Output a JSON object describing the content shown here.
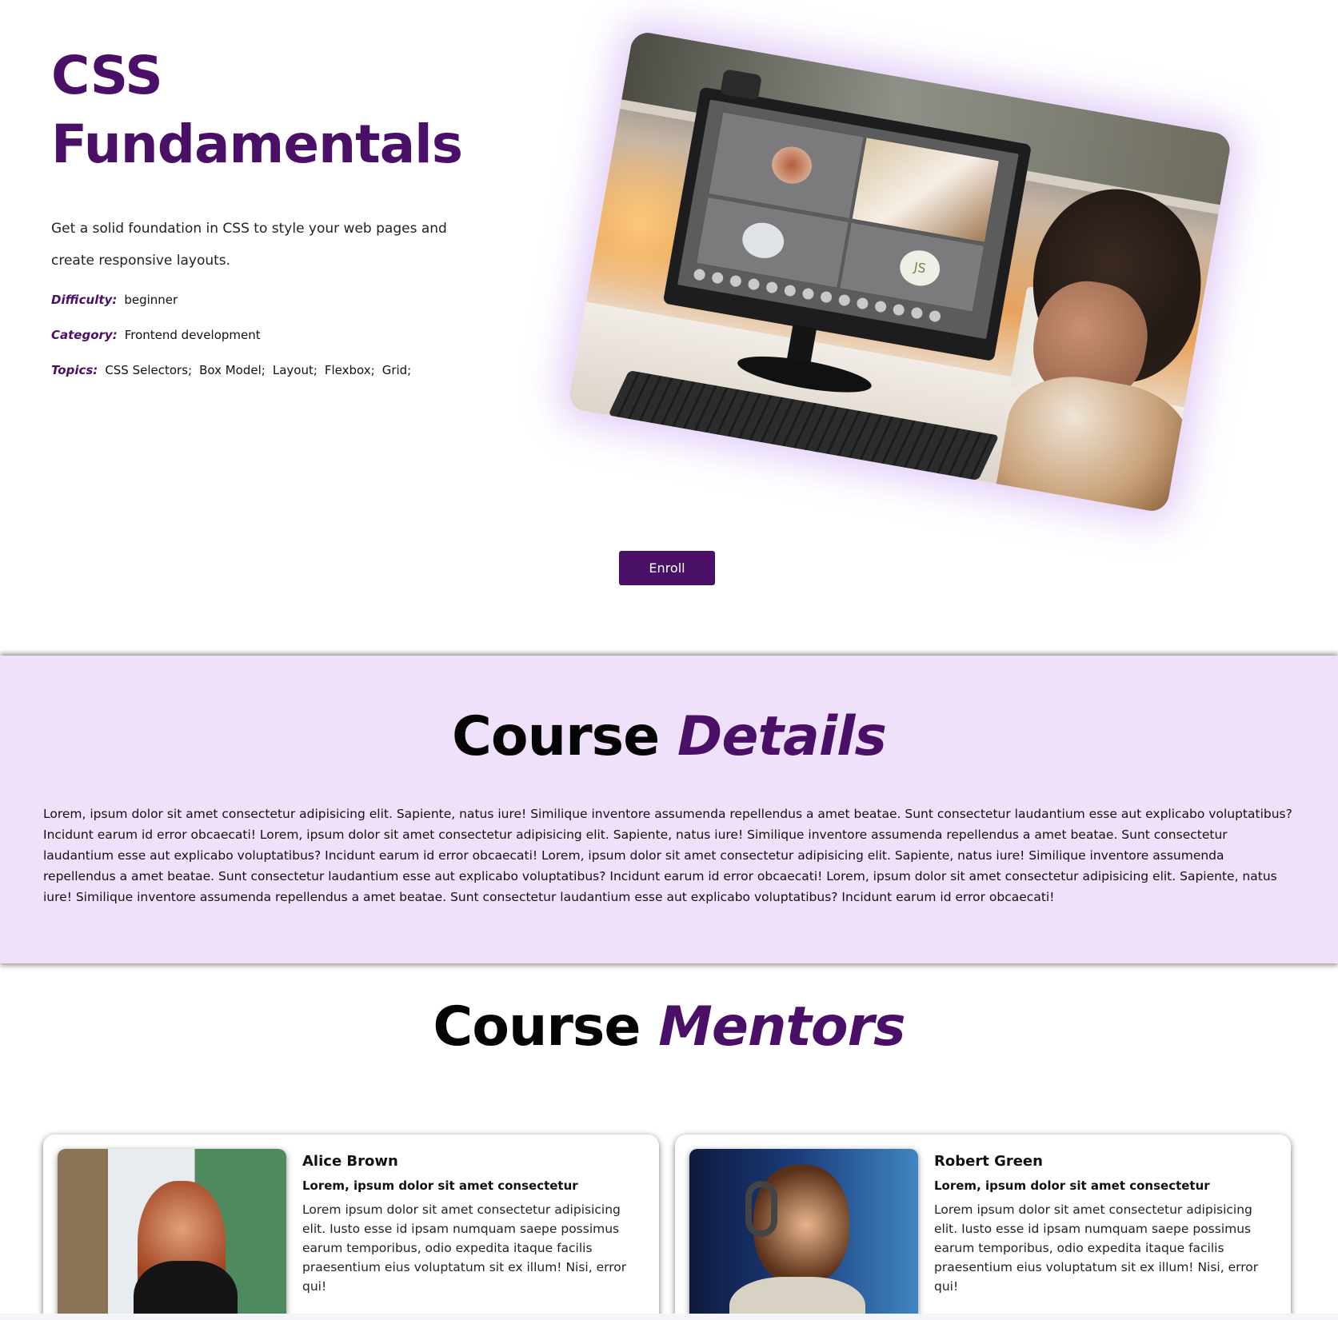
{
  "hero": {
    "title_line1": "CSS",
    "title_line2": "Fundamentals",
    "description": "Get a solid foundation in CSS to style your web pages and create responsive layouts.",
    "difficulty_label": "Difficulty:",
    "difficulty_value": "beginner",
    "category_label": "Category:",
    "category_value": "Frontend development",
    "topics_label": "Topics:",
    "topics": [
      "CSS Selectors;",
      "Box Model;",
      "Layout;",
      "Flexbox;",
      "Grid;"
    ],
    "image_caption_avatar": "JS",
    "enroll_label": "Enroll"
  },
  "details": {
    "title_plain": "Course",
    "title_accent": "Details",
    "body": "Lorem, ipsum dolor sit amet consectetur adipisicing elit. Sapiente, natus iure! Similique inventore assumenda repellendus a amet beatae. Sunt consectetur laudantium esse aut explicabo voluptatibus? Incidunt earum id error obcaecati! Lorem, ipsum dolor sit amet consectetur adipisicing elit. Sapiente, natus iure! Similique inventore assumenda repellendus a amet beatae. Sunt consectetur laudantium esse aut explicabo voluptatibus? Incidunt earum id error obcaecati! Lorem, ipsum dolor sit amet consectetur adipisicing elit. Sapiente, natus iure! Similique inventore assumenda repellendus a amet beatae. Sunt consectetur laudantium esse aut explicabo voluptatibus? Incidunt earum id error obcaecati! Lorem, ipsum dolor sit amet consectetur adipisicing elit. Sapiente, natus iure! Similique inventore assumenda repellendus a amet beatae. Sunt consectetur laudantium esse aut explicabo voluptatibus? Incidunt earum id error obcaecati!"
  },
  "mentors": {
    "title_plain": "Course",
    "title_accent": "Mentors",
    "items": [
      {
        "name": "Alice Brown",
        "subtitle": "Lorem, ipsum dolor sit amet consectetur",
        "bio": "Lorem ipsum dolor sit amet consectetur adipisicing elit. Iusto esse id ipsam numquam saepe possimus earum temporibus, odio expedita itaque facilis praesentium eius voluptatum sit ex illum! Nisi, error qui!"
      },
      {
        "name": "Robert Green",
        "subtitle": "Lorem, ipsum dolor sit amet consectetur",
        "bio": "Lorem ipsum dolor sit amet consectetur adipisicing elit. Iusto esse id ipsam numquam saepe possimus earum temporibus, odio expedita itaque facilis praesentium eius voluptatum sit ex illum! Nisi, error qui!"
      }
    ]
  },
  "colors": {
    "brand_purple": "#4a1068",
    "details_bg": "#f0e1fa",
    "image_glow": "#c496f0"
  }
}
